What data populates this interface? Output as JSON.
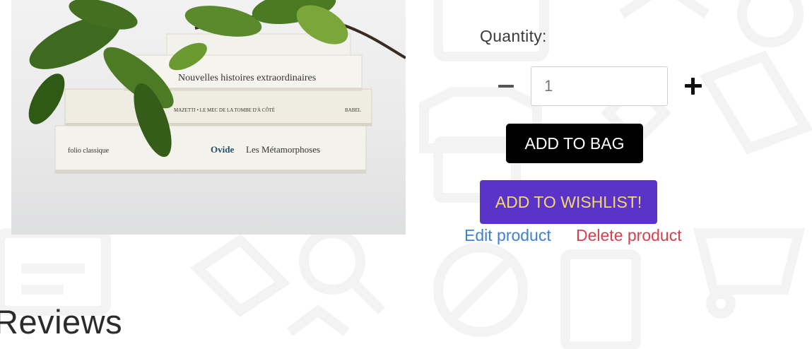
{
  "product": {
    "image_alt": "Stack of books with green leaves",
    "book_spines": [
      "Nouvelles histoires extraordinaires",
      "MAZETTI • LE MEC DE LA TOMBE D'À CÔTÉ",
      "BABEL",
      "folio classique",
      "Ovide",
      "Les Métamorphoses"
    ]
  },
  "quantity": {
    "label": "Quantity:",
    "value": "1"
  },
  "actions": {
    "add_to_bag": "ADD TO BAG",
    "add_to_wishlist": "ADD TO WISHLIST!",
    "edit": "Edit product",
    "delete": "Delete product"
  },
  "reviews": {
    "heading": "Reviews"
  },
  "colors": {
    "wishlist_bg": "#5a33c9",
    "wishlist_text": "#f3d86a",
    "edit_link": "#3f7fd4",
    "delete_link": "#d4424e",
    "bag_bg": "#000000"
  }
}
